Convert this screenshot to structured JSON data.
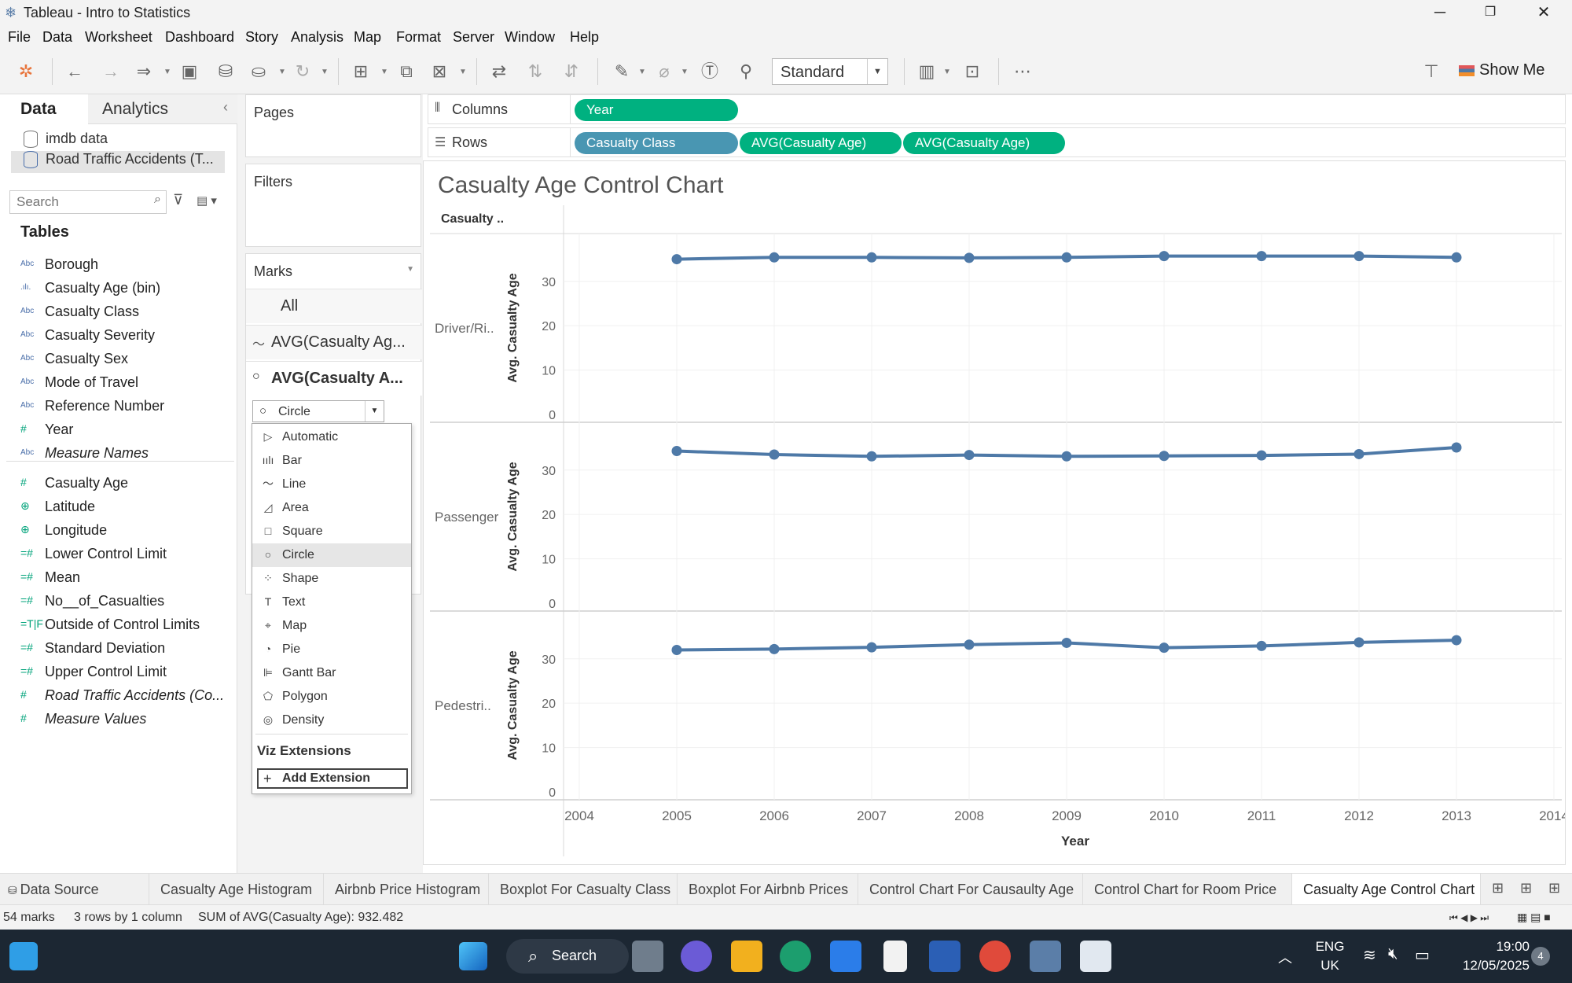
{
  "window": {
    "title": "Tableau - Intro to Statistics",
    "minimize": "─",
    "maximize": "❐",
    "close": "✕"
  },
  "menu": [
    "File",
    "Data",
    "Worksheet",
    "Dashboard",
    "Story",
    "Analysis",
    "Map",
    "Format",
    "Server",
    "Window",
    "Help"
  ],
  "toolbar": {
    "fit_value": "Standard",
    "show_me_label": "Show Me"
  },
  "data_pane": {
    "tab_data": "Data",
    "tab_analytics": "Analytics",
    "datasources": [
      "imdb data",
      "Road Traffic Accidents (T..."
    ],
    "search_placeholder": "Search",
    "tables_heading": "Tables",
    "fields": [
      {
        "type": "Abc",
        "name": "Borough"
      },
      {
        "type": ".ılı.",
        "name": "Casualty Age (bin)"
      },
      {
        "type": "Abc",
        "name": "Casualty Class"
      },
      {
        "type": "Abc",
        "name": "Casualty Severity"
      },
      {
        "type": "Abc",
        "name": "Casualty Sex"
      },
      {
        "type": "Abc",
        "name": "Mode of Travel"
      },
      {
        "type": "Abc",
        "name": "Reference Number"
      },
      {
        "type": "#",
        "name": "Year"
      },
      {
        "type": "Abc",
        "name": "Measure Names"
      },
      {
        "type": "#",
        "name": "Casualty Age"
      },
      {
        "type": "⊕",
        "name": "Latitude"
      },
      {
        "type": "⊕",
        "name": "Longitude"
      },
      {
        "type": "=#",
        "name": "Lower Control Limit"
      },
      {
        "type": "=#",
        "name": "Mean"
      },
      {
        "type": "=#",
        "name": "No__of_Casualties"
      },
      {
        "type": "=T|F",
        "name": "Outside of Control Limits"
      },
      {
        "type": "=#",
        "name": "Standard Deviation"
      },
      {
        "type": "=#",
        "name": "Upper Control Limit"
      },
      {
        "type": "#",
        "name": "Road Traffic Accidents (Co..."
      },
      {
        "type": "#",
        "name": "Measure Values"
      }
    ]
  },
  "shelves": {
    "pages": "Pages",
    "filters": "Filters",
    "marks": "Marks",
    "marks_all": "All",
    "marks_line": "AVG(Casualty Ag...",
    "marks_circle": "AVG(Casualty A...",
    "mark_type_selected": "Circle",
    "columns_label": "Columns",
    "rows_label": "Rows",
    "columns_pills": [
      "Year"
    ],
    "rows_pills": [
      "Casualty Class",
      "AVG(Casualty Age)",
      "AVG(Casualty Age)"
    ]
  },
  "mark_type_dropdown": {
    "options": [
      "Automatic",
      "Bar",
      "Line",
      "Area",
      "Square",
      "Circle",
      "Shape",
      "Text",
      "Map",
      "Pie",
      "Gantt Bar",
      "Polygon",
      "Density"
    ],
    "selected": "Circle",
    "extensions_heading": "Viz Extensions",
    "add_extension": "Add Extension"
  },
  "sheet_tabs": {
    "data_source": "Data Source",
    "tabs": [
      "Casualty Age Histogram",
      "Airbnb Price Histogram",
      "Boxplot For Casualty Class",
      "Boxplot For Airbnb Prices",
      "Control Chart For Causaulty Age",
      "Control Chart for Room Price",
      "Casualty Age Control Chart"
    ],
    "active": "Casualty Age Control Chart"
  },
  "status": {
    "marks": "54 marks",
    "dims": "3 rows by 1 column",
    "sum": "SUM of AVG(Casualty Age): 932.482"
  },
  "taskbar": {
    "search_label": "Search",
    "lang_top": "ENG",
    "lang_bottom": "UK",
    "time": "19:00",
    "date": "12/05/2025",
    "notif_count": "4"
  },
  "colors": {
    "line": "#4e79a7",
    "pill_green": "#00b180",
    "pill_blue": "#4996b2"
  },
  "chart_data": {
    "type": "line",
    "title": "Casualty Age Control Chart",
    "row_header": "Casualty ..",
    "xlabel": "Year",
    "ylabel": "Avg. Casualty Age",
    "x": [
      2005,
      2006,
      2007,
      2008,
      2009,
      2010,
      2011,
      2012,
      2013
    ],
    "xlim": [
      2004,
      2014
    ],
    "x_ticks": [
      2004,
      2005,
      2006,
      2007,
      2008,
      2009,
      2010,
      2011,
      2012,
      2013,
      2014
    ],
    "ylim": [
      0,
      39
    ],
    "y_ticks": [
      0,
      10,
      20,
      30
    ],
    "grid": true,
    "series": [
      {
        "name": "Driver/Ri..",
        "values": [
          35.0,
          35.4,
          35.4,
          35.3,
          35.4,
          35.7,
          35.7,
          35.7,
          35.4
        ]
      },
      {
        "name": "Passenger",
        "values": [
          34.3,
          33.5,
          33.1,
          33.4,
          33.1,
          33.2,
          33.3,
          33.6,
          35.1
        ]
      },
      {
        "name": "Pedestri..",
        "values": [
          32.0,
          32.2,
          32.6,
          33.2,
          33.6,
          32.5,
          32.9,
          33.7,
          34.2
        ]
      }
    ]
  }
}
